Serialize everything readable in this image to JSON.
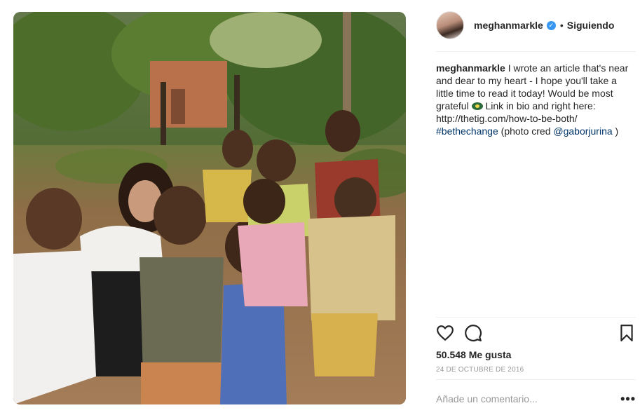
{
  "post": {
    "image_alt": "photo",
    "author": {
      "username": "meghanmarkle",
      "verified_icon": "verified-badge-icon",
      "separator": "•",
      "follow_status": "Siguiendo"
    },
    "caption": {
      "username": "meghanmarkle",
      "text_part1": " I wrote an article that's near and dear to my heart - I hope you'll take a little time to read it today! Would be most grateful ",
      "emoji": "eyes-emoji",
      "text_part2": " Link in bio and right here: http://thetig.com/how-to-be-both/",
      "hashtag": "#bethechange",
      "text_part3": " (photo cred ",
      "mention": "@gaborjurina",
      "text_part4": " )"
    },
    "actions": {
      "like_icon": "heart-icon",
      "comment_icon": "comment-bubble-icon",
      "save_icon": "bookmark-icon"
    },
    "likes_label": "50.548 Me gusta",
    "date": "24 DE OCTUBRE DE 2016",
    "comment_placeholder": "Añade un comentario...",
    "more_options": "•••"
  }
}
